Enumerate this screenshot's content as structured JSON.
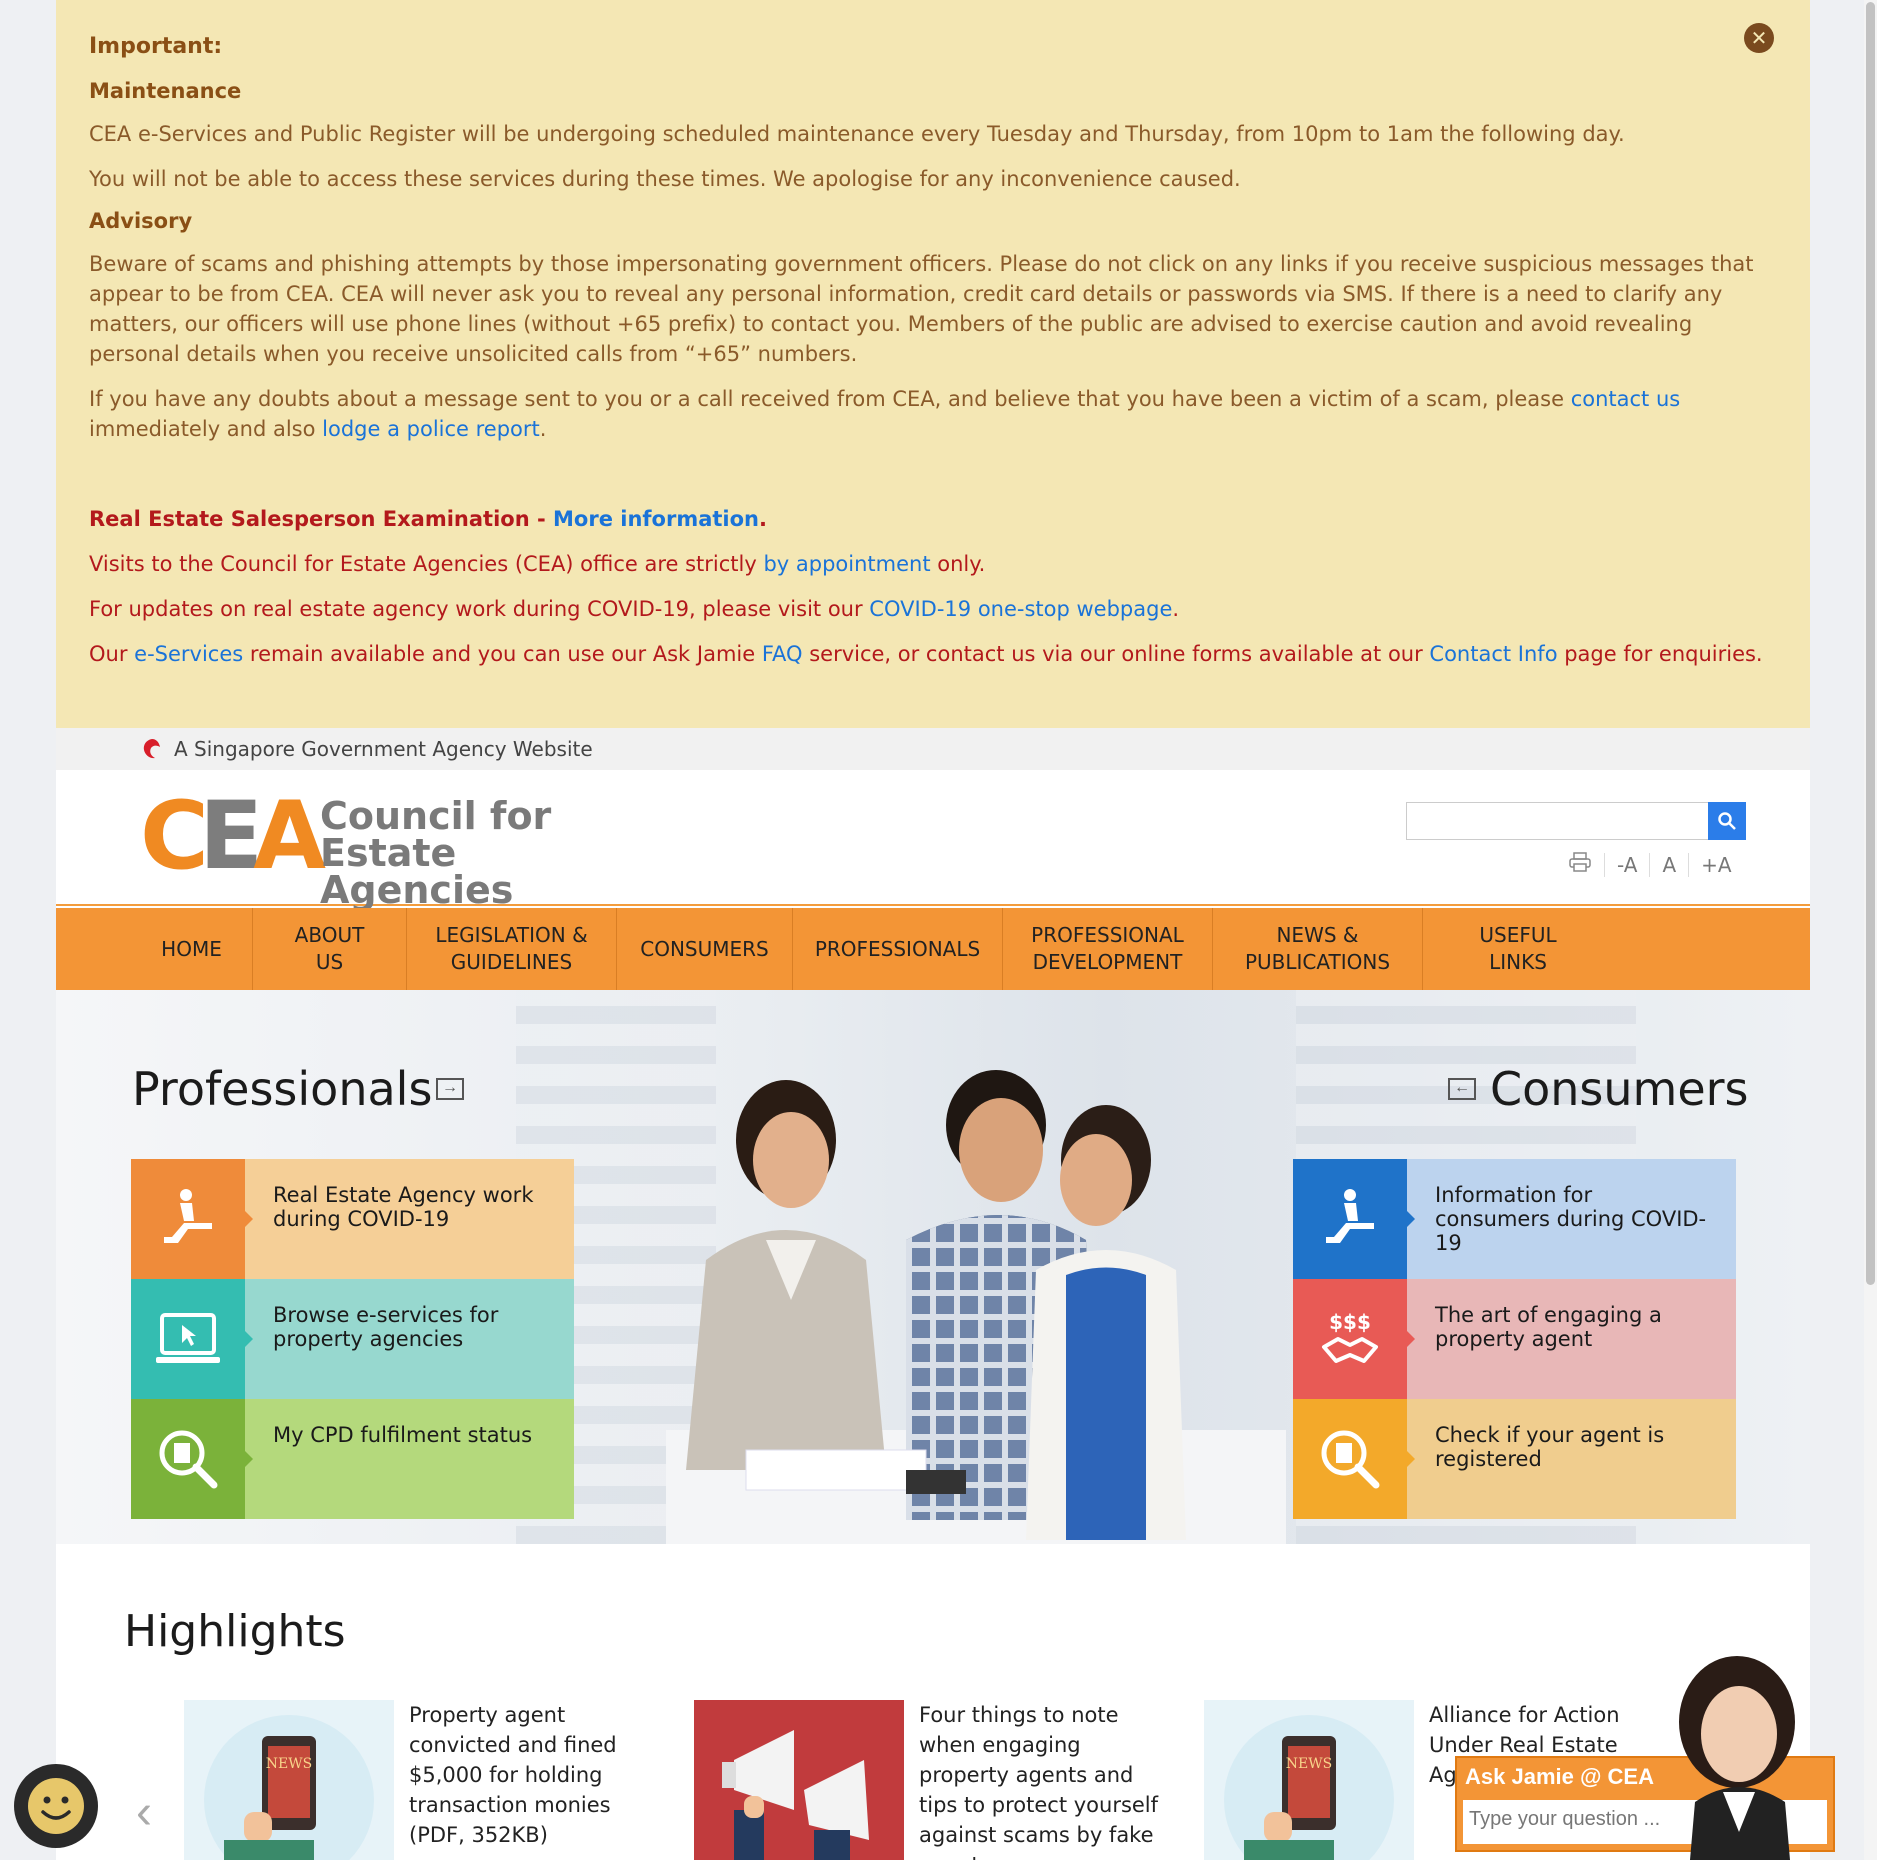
{
  "notice": {
    "heading": "Important:",
    "maintenance_heading": "Maintenance",
    "maintenance_p1": "CEA e-Services and Public Register will be undergoing scheduled maintenance every Tuesday and Thursday, from 10pm to 1am the following day.",
    "maintenance_p2": "You will not be able to access these services during these times. We apologise for any inconvenience caused.",
    "advisory_heading": "Advisory",
    "advisory_p1": "Beware of scams and phishing attempts by those impersonating government officers. Please do not click on any links if you receive suspicious messages that appear to be from CEA. CEA will never ask you to reveal any personal information, credit card details or passwords via SMS. If there is a need to clarify any matters, our officers will use phone lines (without +65 prefix) to contact you. Members of the public are advised to exercise caution and avoid revealing personal details when you receive unsolicited calls from “+65” numbers.",
    "advisory_p2_a": "If you have any doubts about a message sent to you or a call received from CEA, and believe that you have been a victim of a scam, please ",
    "advisory_p2_link1": "contact us",
    "advisory_p2_b": " immediately and also ",
    "advisory_p2_link2": "lodge a police report",
    "advisory_p2_c": ".",
    "exam_text": "Real Estate Salesperson Examination - ",
    "exam_link": "More information",
    "exam_end": ".",
    "visits_a": "Visits to the Council for Estate Agencies (CEA) office are strictly ",
    "visits_link": "by appointment",
    "visits_b": " only.",
    "covid_a": "For updates on real estate agency work during COVID-19, please visit our ",
    "covid_link": "COVID-19 one-stop webpage",
    "covid_b": ".",
    "eserv_a": "Our ",
    "eserv_link1": "e-Services",
    "eserv_b": " remain available and you can use our Ask Jamie ",
    "eserv_link2": "FAQ",
    "eserv_c": " service, or contact us via our online forms available at our ",
    "eserv_link3": "Contact Info",
    "eserv_d": " page for enquiries.",
    "close_glyph": "✕"
  },
  "govbar": {
    "text": "A Singapore Government Agency Website"
  },
  "header": {
    "logo_letters": [
      "C",
      "E",
      "A"
    ],
    "logo_line1": "Council for",
    "logo_line2": "Estate Agencies",
    "search_placeholder": "",
    "tools": [
      "-A",
      "A",
      "+A"
    ]
  },
  "nav": {
    "items": [
      {
        "line1": "HOME",
        "line2": ""
      },
      {
        "line1": "ABOUT US",
        "line2": ""
      },
      {
        "line1": "LEGISLATION &",
        "line2": "GUIDELINES"
      },
      {
        "line1": "CONSUMERS",
        "line2": ""
      },
      {
        "line1": "PROFESSIONALS",
        "line2": ""
      },
      {
        "line1": "PROFESSIONAL",
        "line2": "DEVELOPMENT"
      },
      {
        "line1": "NEWS &",
        "line2": "PUBLICATIONS"
      },
      {
        "line1": "USEFUL LINKS",
        "line2": ""
      }
    ]
  },
  "hero": {
    "professionals_title": "Professionals",
    "consumers_title": "Consumers",
    "professionals_tiles": [
      {
        "label": "Real Estate Agency work during COVID-19",
        "icon": "person-escalator-icon",
        "icon_bg": "#ef8b3a",
        "text_bg": "#f5cf97"
      },
      {
        "label": "Browse e-services for property agencies",
        "icon": "laptop-cursor-icon",
        "icon_bg": "#34bdb1",
        "text_bg": "#97d8cf"
      },
      {
        "label": "My CPD fulfilment status",
        "icon": "magnifier-document-icon",
        "icon_bg": "#7bb23a",
        "text_bg": "#b4d97c"
      }
    ],
    "consumers_tiles": [
      {
        "label": "Information for consumers during COVID-19",
        "icon": "person-escalator-icon",
        "icon_bg": "#1f73c9",
        "text_bg": "#bcd3ee"
      },
      {
        "label": "The art of engaging a property agent",
        "icon": "handshake-money-icon",
        "icon_bg": "#e85a55",
        "text_bg": "#e8b7b7"
      },
      {
        "label": "Check if your agent is registered",
        "icon": "magnifier-document-icon",
        "icon_bg": "#f3a92a",
        "text_bg": "#f0cd8e"
      }
    ]
  },
  "highlights": {
    "title": "Highlights",
    "prev": "‹",
    "cards": [
      {
        "text": "Property agent convicted and fined $5,000 for holding transaction monies (PDF, 352KB)",
        "thumb": "news-phone"
      },
      {
        "text": "Four things to note when engaging property agents and tips to protect yourself against scams by fake agents",
        "thumb": "megaphones"
      },
      {
        "text": "Alliance for Action Under Real Estate Agency Ind pro exp",
        "thumb": "news-phone"
      }
    ],
    "news_label": "NEWS"
  },
  "jamie": {
    "title": "Ask Jamie @ CEA",
    "placeholder": "Type your question ..."
  },
  "colors": {
    "accent": "#f39536",
    "notice_bg": "#f4e7b4",
    "link": "#1a73d8",
    "alert_red": "#b3191c"
  }
}
